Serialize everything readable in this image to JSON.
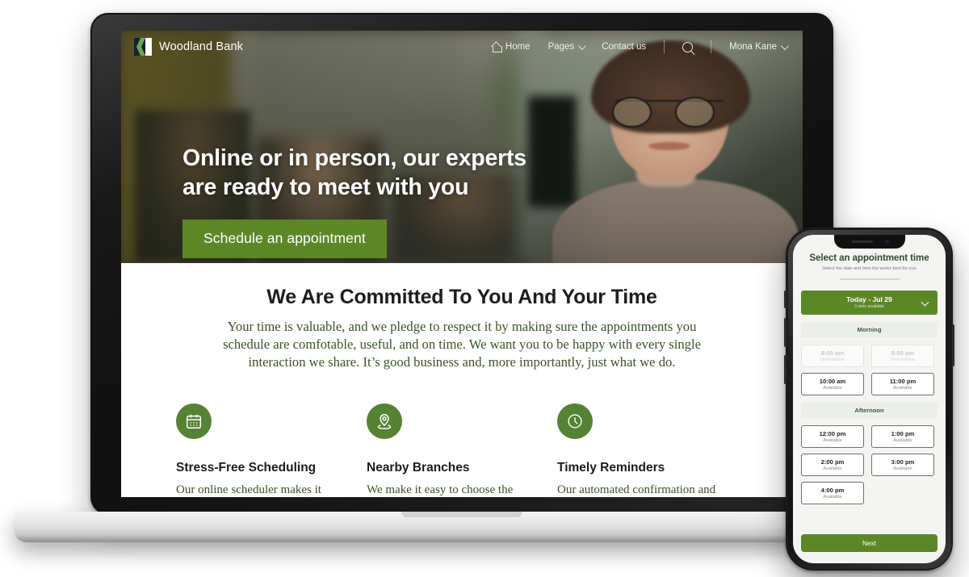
{
  "site": {
    "brand": "Woodland Bank",
    "nav": [
      {
        "label": "Home",
        "icon": "home-icon",
        "caret": false
      },
      {
        "label": "Pages",
        "icon": "",
        "caret": true
      },
      {
        "label": "Contact us",
        "icon": "",
        "caret": false
      }
    ],
    "search_icon": "search-icon",
    "account": {
      "label": "Mona Kane",
      "caret": true
    }
  },
  "hero": {
    "title_line1": "Online or in person, our experts",
    "title_line2": "are ready to meet with you",
    "cta_label": "Schedule an appointment"
  },
  "committed": {
    "title": "We Are Committed To You And Your Time",
    "body": "Your time is valuable, and we pledge to respect it by making sure the appointments you schedule are comfotable, useful, and on time. We want you to be happy with every single interaction we share. It’s good business and, more importantly, just what we do."
  },
  "features": [
    {
      "icon": "calendar-icon",
      "title": "Stress-Free Scheduling",
      "text": "Our online scheduler makes it easy to get the meeting time"
    },
    {
      "icon": "map-pin-icon",
      "title": "Nearby Branches",
      "text": "We make it easy to choose the location to meet that is"
    },
    {
      "icon": "clock-icon",
      "title": "Timely Reminders",
      "text": "Our automated confirmation and reminder messages helps"
    }
  ],
  "phone": {
    "title": "Select an appointment time",
    "subtitle": "Select the date and time the works best for you",
    "date_picker": {
      "label": "Today - Jul 29",
      "sublabel": "3 slots available",
      "caret_icon": "chevron-down-icon"
    },
    "groups": [
      {
        "period": "Morning",
        "slots": [
          {
            "time": "8:00 am",
            "status": "Unavailable",
            "available": false
          },
          {
            "time": "9:00 pm",
            "status": "Unavailable",
            "available": false
          },
          {
            "time": "10:00 am",
            "status": "Available",
            "available": true
          },
          {
            "time": "11:00 pm",
            "status": "Available",
            "available": true
          }
        ]
      },
      {
        "period": "Afternoon",
        "slots": [
          {
            "time": "12:00 pm",
            "status": "Available",
            "available": true
          },
          {
            "time": "1:00 pm",
            "status": "Available",
            "available": true
          },
          {
            "time": "2:00 pm",
            "status": "Available",
            "available": true
          },
          {
            "time": "3:00 pm",
            "status": "Available",
            "available": true
          },
          {
            "time": "4:00 pm",
            "status": "Available",
            "available": true
          }
        ]
      }
    ],
    "next_label": "Next"
  },
  "colors": {
    "green": "#5c8727",
    "icon_green": "#558234",
    "serif_text": "#3b5226",
    "phone_title": "#2f4a30"
  }
}
